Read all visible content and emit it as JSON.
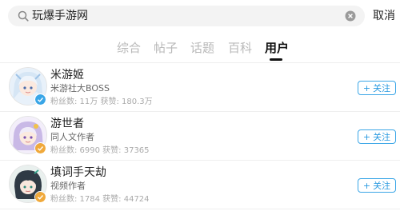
{
  "search": {
    "query": "玩爆手游网",
    "cancel_label": "取消"
  },
  "tabs": [
    {
      "label": "综合"
    },
    {
      "label": "帖子"
    },
    {
      "label": "话题"
    },
    {
      "label": "百科"
    },
    {
      "label": "用户"
    }
  ],
  "active_tab": "用户",
  "users": [
    {
      "name": "米游姬",
      "desc": "米游社大BOSS",
      "stats": "粉丝数: 11万 获赞: 180.3万",
      "follow_plus": "+",
      "follow_label": "关注",
      "badge_color": "#3aa6e7"
    },
    {
      "name": "游世者",
      "desc": "同人文作者",
      "stats": "粉丝数: 6990 获赞: 37365",
      "follow_plus": "+",
      "follow_label": "关注",
      "badge_color": "#f0a93b"
    },
    {
      "name": "填词手天劫",
      "desc": "视频作者",
      "stats": "粉丝数: 1784 获赞: 44724",
      "follow_plus": "+",
      "follow_label": "关注",
      "badge_color": "#f0a93b"
    }
  ],
  "colors": {
    "accent": "#2a9ae0",
    "tab_inactive": "#b9b9b9"
  }
}
